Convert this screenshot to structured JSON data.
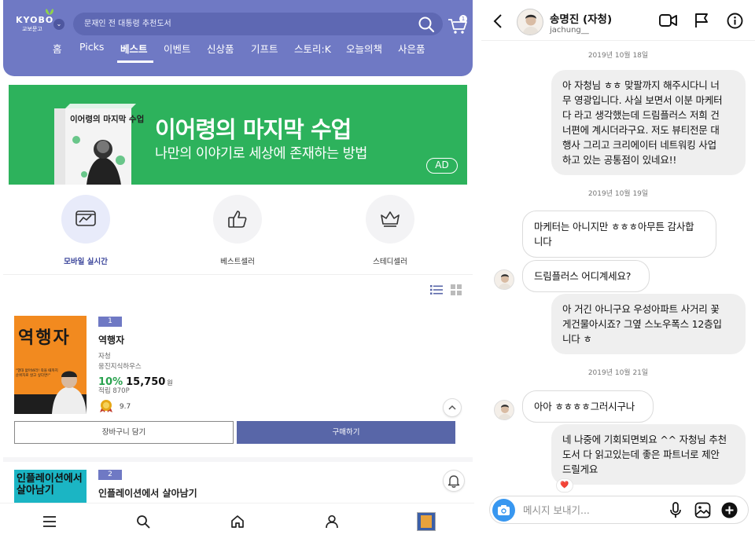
{
  "left_app": {
    "logo": {
      "line1": "KYOBO",
      "line2": "교보문고"
    },
    "search": {
      "placeholder": "문재인 전 대통령 추천도서"
    },
    "cart_badge": "1",
    "nav": [
      {
        "label": "홈"
      },
      {
        "label": "Picks"
      },
      {
        "label": "베스트",
        "active": true
      },
      {
        "label": "이벤트"
      },
      {
        "label": "신상품"
      },
      {
        "label": "기프트"
      },
      {
        "label": "스토리:K"
      },
      {
        "label": "오늘의책"
      },
      {
        "label": "사은품"
      }
    ],
    "banner": {
      "title": "이어령의 마지막 수업",
      "subtitle": "나만의 이야기로 세상에 존재하는 방법",
      "badge": "AD",
      "book_title": "이어령의 마지막 수업",
      "color": "#2db25c"
    },
    "quick_menu": [
      {
        "label": "모바일 실시간",
        "icon": "chart-monitor-icon",
        "active": true
      },
      {
        "label": "베스트셀러",
        "icon": "thumbs-up-icon"
      },
      {
        "label": "스테디셀러",
        "icon": "crown-icon"
      }
    ],
    "books": [
      {
        "rank": "1",
        "title": "역행자",
        "author": "자청",
        "publisher": "웅진지식하우스",
        "discount": "10%",
        "price": "15,750",
        "currency": "원",
        "points": "적립 870P",
        "rating": "9.7",
        "cover_title": "역행자",
        "cover_blurb": "\"열대 없어봐라! 죽을 때까지 순위자로 살고 싶다면!\"",
        "cart_label": "장바구니 담기",
        "buy_label": "구매하기"
      },
      {
        "rank": "2",
        "title": "인플레이션에서 살아남기",
        "cover_title_1": "인플레이션에서",
        "cover_title_2": "살아남기"
      }
    ],
    "bottom_nav": [
      "menu-icon",
      "search-icon",
      "home-icon",
      "user-icon",
      "recent-book-thumbnail"
    ],
    "accent": "#6f79c4",
    "buy_color": "#5866a8",
    "discount_color": "#2aa24f"
  },
  "chat": {
    "contact_name": "송명진 (자청)",
    "contact_handle": "jachung__",
    "messages": [
      {
        "type": "date",
        "text": "2019년 10월 18일"
      },
      {
        "type": "out",
        "lines": [
          "아 자청님 ㅎㅎ 맞팔까지 해주시다니 너",
          "무 영광입니다. 사실 보면서 이분 마케터",
          "다 라고 생각했는데 드림플러스 저희 건",
          "너편에 계시더라구요. 저도 뷰티전문 대",
          "행사 그리고 크리에이터 네트워킹 사업",
          "하고 있는 공통점이 있네요!!"
        ]
      },
      {
        "type": "date",
        "text": "2019년 10월 19일"
      },
      {
        "type": "in",
        "lines": [
          "마케터는 아니지만 ㅎㅎㅎ아무튼 감사합",
          "니다"
        ]
      },
      {
        "type": "in",
        "lines": [
          "드림플러스 어디계세요?"
        ]
      },
      {
        "type": "out",
        "lines": [
          "아 거긴 아니구요 우성아파트 사거리  꽃",
          "게건물아시죠?  그옆 스노우폭스 12층입",
          "니다 ㅎ"
        ]
      },
      {
        "type": "date",
        "text": "2019년 10월 21일"
      },
      {
        "type": "in",
        "lines": [
          "아아 ㅎㅎㅎㅎ그러시구나"
        ]
      },
      {
        "type": "out",
        "lines": [
          "네 나중에 기회되면뵈요 ^^ 자청님 추천",
          "도서 다 읽고있는데 좋은 파트너로 제안",
          "드릴게요"
        ],
        "reaction": "❤️"
      }
    ],
    "composer": {
      "placeholder": "메시지 보내기..."
    },
    "colors": {
      "outgoing_bubble": "#efefef",
      "camera_button": "#3897f0"
    }
  }
}
